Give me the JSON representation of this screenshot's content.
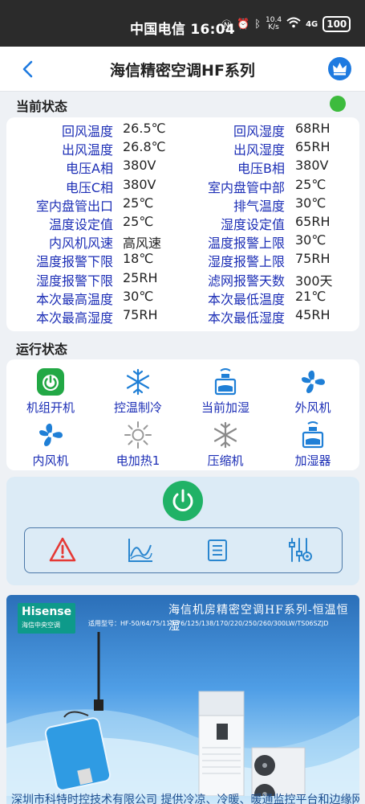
{
  "statusbar": {
    "carrier_time": "中国电信 16:04",
    "net_speed_value": "10.4",
    "net_speed_unit": "K/s",
    "signal": "4G",
    "battery": "100"
  },
  "header": {
    "title": "海信精密空调HF系列",
    "back_icon": "chevron-left-icon",
    "crown_icon": "crown-icon"
  },
  "current_status": {
    "title": "当前状态",
    "indicator_color": "#3dbb3d",
    "rows": [
      {
        "l1": "回风温度",
        "v1": "26.5℃",
        "l2": "回风湿度",
        "v2": "68RH"
      },
      {
        "l1": "出风温度",
        "v1": "26.8℃",
        "l2": "出风湿度",
        "v2": "65RH"
      },
      {
        "l1": "电压A相",
        "v1": "380V",
        "l2": "电压B相",
        "v2": "380V"
      },
      {
        "l1": "电压C相",
        "v1": "380V",
        "l2": "室内盘管中部",
        "v2": "25℃"
      },
      {
        "l1": "室内盘管出口",
        "v1": "25℃",
        "l2": "排气温度",
        "v2": "30℃"
      },
      {
        "l1": "温度设定值",
        "v1": "25℃",
        "l2": "湿度设定值",
        "v2": "65RH"
      },
      {
        "l1": "内风机风速",
        "v1": "高风速",
        "l2": "温度报警上限",
        "v2": "30℃"
      },
      {
        "l1": "温度报警下限",
        "v1": "18℃",
        "l2": "湿度报警上限",
        "v2": "75RH"
      },
      {
        "l1": "湿度报警下限",
        "v1": "25RH",
        "l2": "滤网报警天数",
        "v2": "300天"
      },
      {
        "l1": "本次最高温度",
        "v1": "30℃",
        "l2": "本次最低温度",
        "v2": "21℃"
      },
      {
        "l1": "本次最高湿度",
        "v1": "75RH",
        "l2": "本次最低湿度",
        "v2": "45RH"
      }
    ]
  },
  "operating_status": {
    "title": "运行状态",
    "items": [
      {
        "label": "机组开机",
        "icon": "power-on-icon"
      },
      {
        "label": "控温制冷",
        "icon": "snowflake-icon"
      },
      {
        "label": "当前加湿",
        "icon": "humidifier-icon"
      },
      {
        "label": "外风机",
        "icon": "fan-icon"
      },
      {
        "label": "内风机",
        "icon": "fan-icon"
      },
      {
        "label": "电加热1",
        "icon": "heater-icon"
      },
      {
        "label": "压缩机",
        "icon": "compressor-icon"
      },
      {
        "label": "加湿器",
        "icon": "humidifier-icon"
      }
    ]
  },
  "controls": {
    "power_icon": "power-icon",
    "tools": [
      "alarm-icon",
      "trend-chart-icon",
      "list-icon",
      "settings-sliders-icon"
    ],
    "accent": "#20b266",
    "alarm_color": "#e53935",
    "tool_color": "#2a86cf"
  },
  "banner": {
    "brand": "Hisense",
    "brand_sub": "海信中央空调",
    "headline": "海信机房精密空调HF系列-恒温恒湿",
    "models": "适用型号：HF-50/64/75/110/76/125/138/170/220/250/260/300LW/TS06SZJD",
    "footer": "深圳市科特时控技术有限公司  提供冷凉、冷暖、暖通监控平台和边缘网关"
  }
}
